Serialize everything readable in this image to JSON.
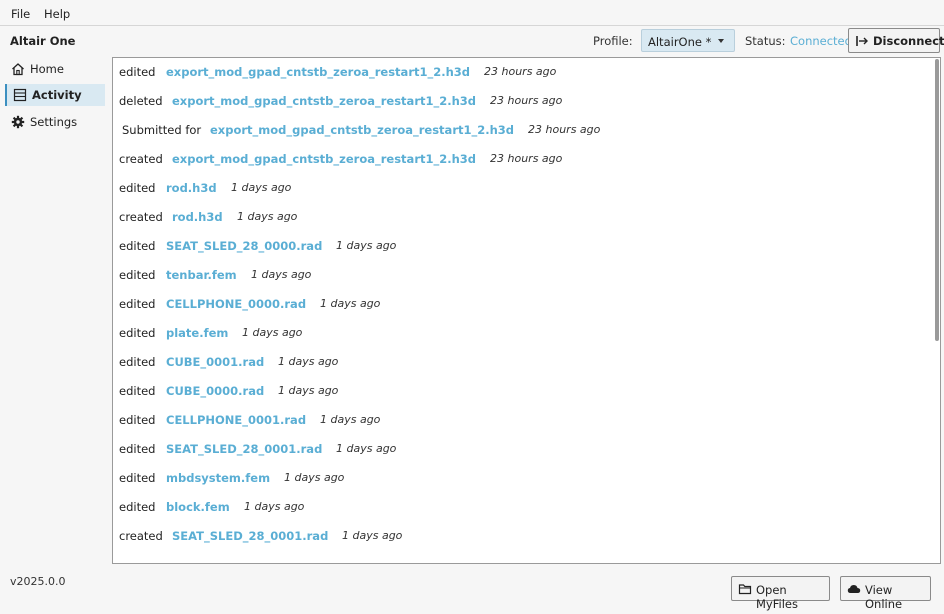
{
  "menu": {
    "file": "File",
    "help": "Help"
  },
  "app_title": "Altair One",
  "header": {
    "profile_label": "Profile:",
    "profile_value": "AltairOne *",
    "status_label": "Status:",
    "status_value": "Connected",
    "disconnect_label": "Disconnect"
  },
  "nav": {
    "home": "Home",
    "activity": "Activity",
    "settings": "Settings"
  },
  "activity": [
    {
      "action": "edited",
      "file": "export_mod_gpad_cntstb_zeroa_restart1_2.h3d",
      "time": "23 hours ago"
    },
    {
      "action": "deleted",
      "file": "export_mod_gpad_cntstb_zeroa_restart1_2.h3d",
      "time": "23 hours ago"
    },
    {
      "action": "Submitted for",
      "file": "export_mod_gpad_cntstb_zeroa_restart1_2.h3d",
      "time": "23 hours ago"
    },
    {
      "action": "created",
      "file": "export_mod_gpad_cntstb_zeroa_restart1_2.h3d",
      "time": "23 hours ago"
    },
    {
      "action": "edited",
      "file": "rod.h3d",
      "time": "1 days ago"
    },
    {
      "action": "created",
      "file": "rod.h3d",
      "time": "1 days ago"
    },
    {
      "action": "edited",
      "file": "SEAT_SLED_28_0000.rad",
      "time": "1 days ago"
    },
    {
      "action": "edited",
      "file": "tenbar.fem",
      "time": "1 days ago"
    },
    {
      "action": "edited",
      "file": "CELLPHONE_0000.rad",
      "time": "1 days ago"
    },
    {
      "action": "edited",
      "file": "plate.fem",
      "time": "1 days ago"
    },
    {
      "action": "edited",
      "file": "CUBE_0001.rad",
      "time": "1 days ago"
    },
    {
      "action": "edited",
      "file": "CUBE_0000.rad",
      "time": "1 days ago"
    },
    {
      "action": "edited",
      "file": "CELLPHONE_0001.rad",
      "time": "1 days ago"
    },
    {
      "action": "edited",
      "file": "SEAT_SLED_28_0001.rad",
      "time": "1 days ago"
    },
    {
      "action": "edited",
      "file": "mbdsystem.fem",
      "time": "1 days ago"
    },
    {
      "action": "edited",
      "file": "block.fem",
      "time": "1 days ago"
    },
    {
      "action": "created",
      "file": "SEAT_SLED_28_0001.rad",
      "time": "1 days ago"
    }
  ],
  "footer": {
    "version": "v2025.0.0",
    "open_myfiles": "Open MyFiles",
    "view_online": "View Online"
  },
  "colors": {
    "link": "#5aaed4",
    "selection": "#d9e9f2",
    "accent": "#3b8fc0"
  }
}
